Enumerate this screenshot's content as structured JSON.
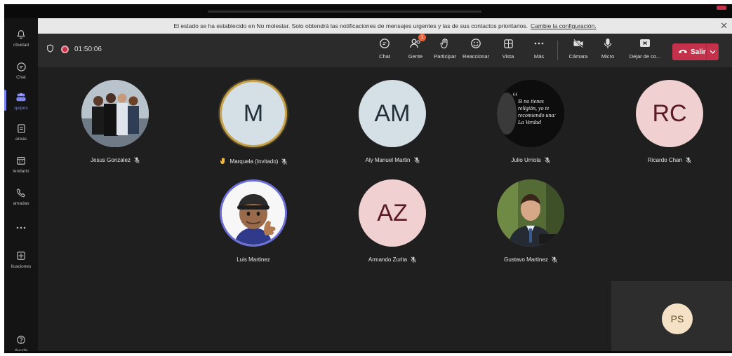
{
  "rail": {
    "items": [
      {
        "label": "ctividad",
        "icon": "bell-icon"
      },
      {
        "label": "Chat",
        "icon": "chat-icon"
      },
      {
        "label": "quipos",
        "icon": "teams-icon",
        "active": true
      },
      {
        "label": "areas",
        "icon": "tasks-icon"
      },
      {
        "label": "lendario",
        "icon": "calendar-icon"
      },
      {
        "label": "amadas",
        "icon": "phone-icon"
      },
      {
        "label": "",
        "icon": "more-icon"
      },
      {
        "label": "licaciones",
        "icon": "apps-icon"
      },
      {
        "label": "Ayuda",
        "icon": "help-icon"
      }
    ]
  },
  "banner": {
    "text": "El estado se ha establecido en No molestar. Solo obtendrá las notificaciones de mensajes urgentes y las de sus contactos prioritarios.",
    "link": "Cambie la configuración.",
    "close": "✕"
  },
  "toolbar": {
    "timer": "01:50:06",
    "buttons": [
      {
        "label": "Chat",
        "icon": "chat-icon"
      },
      {
        "label": "Gente",
        "icon": "people-icon",
        "badge": "1"
      },
      {
        "label": "Participar",
        "icon": "raise-hand-icon"
      },
      {
        "label": "Reaccionar",
        "icon": "smile-icon"
      },
      {
        "label": "Vista",
        "icon": "grid-view-icon"
      },
      {
        "label": "Más",
        "icon": "more-icon"
      },
      {
        "label": "Cámara",
        "icon": "camera-off-icon"
      },
      {
        "label": "Micro",
        "icon": "microphone-icon"
      },
      {
        "label": "Dejar de co...",
        "icon": "stop-share-icon"
      }
    ],
    "leave_label": "Salir"
  },
  "participants": [
    {
      "name": "Jesus Gonzalez",
      "initials": "",
      "photo": true,
      "muted": true
    },
    {
      "name": "Marquela (Invitado)",
      "initials": "M",
      "bg": "#d4dfe6",
      "fg": "#22303a",
      "speaking": true,
      "hand": true,
      "muted": true
    },
    {
      "name": "Aly Manuel Martin",
      "initials": "AM",
      "bg": "#d4dfe6",
      "fg": "#22303a",
      "muted": true
    },
    {
      "name": "Julio Urriola",
      "initials": "",
      "photo": true,
      "muted": true,
      "quote": "Si no tienes religión, yo te recomiendo una: La Verdad"
    },
    {
      "name": "Ricardo Chan",
      "initials": "RC",
      "bg": "#f1d0d2",
      "fg": "#5a1c24",
      "muted": true
    },
    {
      "name": "Luis Martinez",
      "initials": "",
      "photo": true,
      "muted": false,
      "ring": true
    },
    {
      "name": "Armando Zurita",
      "initials": "AZ",
      "bg": "#f1d0d2",
      "fg": "#5a1c24",
      "muted": true
    },
    {
      "name": "Gustavo Martinez",
      "initials": "",
      "photo": true,
      "muted": true
    }
  ],
  "self": {
    "initials": "PS"
  },
  "colors": {
    "accent": "#7f85f5",
    "leave": "#c4314b",
    "speaking": "#c8a24a",
    "badge": "#e9623a"
  }
}
